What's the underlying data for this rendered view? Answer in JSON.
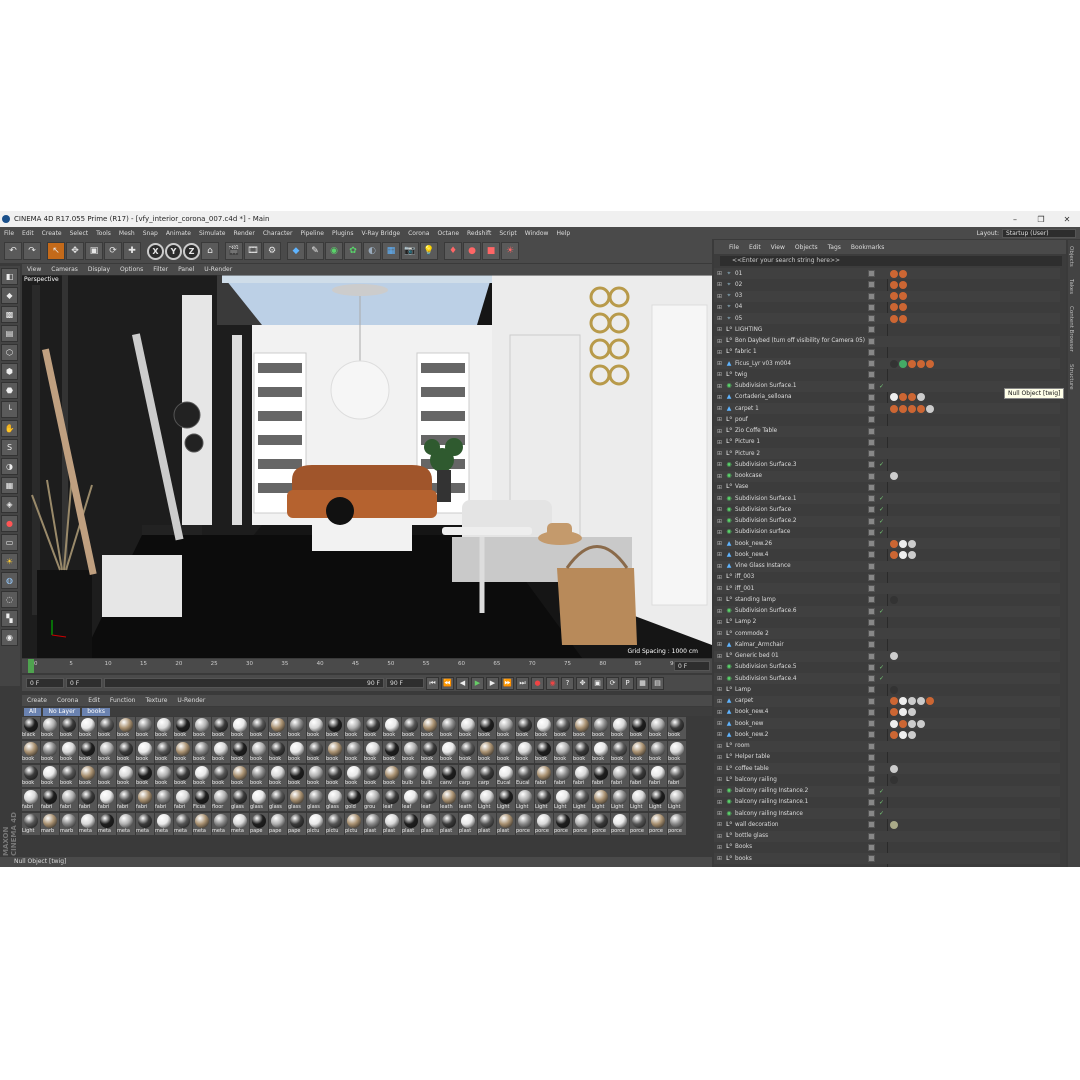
{
  "window": {
    "title": "CINEMA 4D R17.055 Prime (R17) - [vfy_interior_corona_007.c4d *] - Main",
    "min": "–",
    "max": "❐",
    "close": "✕"
  },
  "menu": [
    "File",
    "Edit",
    "Create",
    "Select",
    "Tools",
    "Mesh",
    "Snap",
    "Animate",
    "Simulate",
    "Render",
    "Character",
    "Pipeline",
    "Plugins",
    "V-Ray Bridge",
    "Corona",
    "Octane",
    "Redshift",
    "Script",
    "Window",
    "Help"
  ],
  "layout": {
    "label": "Layout:",
    "value": "Startup (User)"
  },
  "viewport": {
    "menu": [
      "View",
      "Cameras",
      "Display",
      "Options",
      "Filter",
      "Panel",
      "U-Render"
    ],
    "label": "Perspective",
    "grid_spacing": "Grid Spacing : 1000 cm"
  },
  "timeline": {
    "ticks": [
      "0",
      "5",
      "10",
      "15",
      "20",
      "25",
      "30",
      "35",
      "40",
      "45",
      "50",
      "55",
      "60",
      "65",
      "70",
      "75",
      "80",
      "85",
      "90"
    ],
    "end_field": "0 F",
    "start": "0 F",
    "min": "0 F",
    "max_slider": "90 F",
    "max": "90 F"
  },
  "materials": {
    "menu": [
      "Create",
      "Corona",
      "Edit",
      "Function",
      "Texture",
      "U-Render"
    ],
    "filters": [
      "All",
      "No Layer",
      "books"
    ],
    "rows": [
      {
        "labels": [
          "black",
          "book",
          "book",
          "book",
          "book",
          "book",
          "book",
          "book",
          "book",
          "book",
          "book",
          "book",
          "book",
          "book",
          "book",
          "book",
          "book",
          "book",
          "book",
          "book",
          "book",
          "book",
          "book",
          "book",
          "book",
          "book",
          "book",
          "book",
          "book",
          "book",
          "book",
          "book",
          "book",
          "book",
          "book"
        ],
        "color": "#222"
      },
      {
        "labels": [
          "book",
          "book",
          "book",
          "book",
          "book",
          "book",
          "book",
          "book",
          "book",
          "book",
          "book",
          "book",
          "book",
          "book",
          "book",
          "book",
          "book",
          "book",
          "book",
          "book",
          "book",
          "book",
          "book",
          "book",
          "book",
          "book",
          "book",
          "book",
          "book",
          "book",
          "book",
          "book",
          "book",
          "book",
          "book"
        ],
        "color": "#aaa"
      },
      {
        "labels": [
          "book",
          "book",
          "book",
          "book",
          "book",
          "book",
          "book",
          "book",
          "book",
          "book",
          "book",
          "book",
          "book",
          "book",
          "book",
          "book",
          "book",
          "book",
          "book",
          "book",
          "bulb",
          "bulb",
          "canv",
          "carp",
          "carp",
          "Eucal",
          "Eucal",
          "fabri",
          "fabri",
          "fabri",
          "fabri",
          "fabri",
          "fabri",
          "fabri",
          "fabri"
        ],
        "color": "#777"
      },
      {
        "labels": [
          "fabri",
          "fabri",
          "fabri",
          "fabri",
          "fabri",
          "fabri",
          "fabri",
          "fabri",
          "fabri",
          "Ficus",
          "floor",
          "glass",
          "glass",
          "glass",
          "glass",
          "glass",
          "glass",
          "gold",
          "grou",
          "leaf",
          "leaf",
          "leaf",
          "leath",
          "leath",
          "Light",
          "Light",
          "Light",
          "Light",
          "Light",
          "Light",
          "Light",
          "Light",
          "Light",
          "Light",
          "Light"
        ],
        "color": "#8a6a4a"
      },
      {
        "labels": [
          "Light",
          "marb",
          "marb",
          "meta",
          "meta",
          "meta",
          "meta",
          "meta",
          "meta",
          "meta",
          "meta",
          "meta",
          "pape",
          "pape",
          "pape",
          "pictu",
          "pictu",
          "pictu",
          "plast",
          "plast",
          "plast",
          "plast",
          "plast",
          "plast",
          "plast",
          "plast",
          "porce",
          "porce",
          "porce",
          "porce",
          "porce",
          "porce",
          "porce",
          "porce",
          "porce"
        ],
        "color": "#999"
      }
    ]
  },
  "status": "Null Object [twig]",
  "object_manager": {
    "menu": [
      "File",
      "Edit",
      "View",
      "Objects",
      "Tags",
      "Bookmarks"
    ],
    "search_placeholder": "<<Enter your search string here>>",
    "tooltip": "Null Object [twig]",
    "rows": [
      {
        "name": "01",
        "icon": "cam",
        "check": "",
        "tags": [
          "#c63",
          "#c63"
        ]
      },
      {
        "name": "02",
        "icon": "cam",
        "check": "",
        "tags": [
          "#c63",
          "#c63"
        ]
      },
      {
        "name": "03",
        "icon": "cam",
        "check": "",
        "tags": [
          "#c63",
          "#c63"
        ]
      },
      {
        "name": "04",
        "icon": "cam",
        "check": "",
        "tags": [
          "#c63",
          "#c63"
        ]
      },
      {
        "name": "05",
        "icon": "cam",
        "check": "",
        "tags": [
          "#c63",
          "#c63"
        ]
      },
      {
        "name": "LIGHTING",
        "icon": "null",
        "check": "",
        "tags": []
      },
      {
        "name": "Bon Daybed (turn off visibility for Camera 05)",
        "icon": "null",
        "check": "",
        "tags": []
      },
      {
        "name": "fabric 1",
        "icon": "null",
        "check": "",
        "tags": []
      },
      {
        "name": "Ficus_Lyr v03 m004",
        "icon": "poly",
        "check": "",
        "tags": [
          "#333",
          "#4a6",
          "#c63",
          "#c63",
          "#c63"
        ]
      },
      {
        "name": "twig",
        "icon": "null",
        "check": "",
        "tags": []
      },
      {
        "name": "Subdivision Surface.1",
        "icon": "gen",
        "check": "✓",
        "tags": []
      },
      {
        "name": "Cortaderia_selloana",
        "icon": "poly",
        "check": "",
        "tags": [
          "#eee",
          "#c63",
          "#c63",
          "#ccc"
        ]
      },
      {
        "name": "carpet 1",
        "icon": "poly",
        "check": "",
        "tags": [
          "#c63",
          "#c63",
          "#c63",
          "#c63",
          "#ccc"
        ]
      },
      {
        "name": "pouf",
        "icon": "null",
        "check": "",
        "tags": []
      },
      {
        "name": "Zio Coffe Table",
        "icon": "null",
        "check": "",
        "tags": []
      },
      {
        "name": "Picture 1",
        "icon": "null",
        "check": "",
        "tags": []
      },
      {
        "name": "Picture 2",
        "icon": "null",
        "check": "",
        "tags": []
      },
      {
        "name": "Subdivision Surface.3",
        "icon": "gen",
        "check": "✓",
        "tags": []
      },
      {
        "name": "bookcase",
        "icon": "gen",
        "check": "",
        "tags": [
          "#ccc"
        ]
      },
      {
        "name": "Vase",
        "icon": "null",
        "check": "",
        "tags": []
      },
      {
        "name": "Subdivision Surface.1",
        "icon": "gen",
        "check": "✓",
        "tags": []
      },
      {
        "name": "Subdivision Surface",
        "icon": "gen",
        "check": "✓",
        "tags": []
      },
      {
        "name": "Subdivision Surface.2",
        "icon": "gen",
        "check": "✓",
        "tags": []
      },
      {
        "name": "Subdivision surface",
        "icon": "gen",
        "check": "✓",
        "tags": []
      },
      {
        "name": "book_new.26",
        "icon": "poly",
        "check": "",
        "tags": [
          "#c63",
          "#eee",
          "#ccc"
        ]
      },
      {
        "name": "book_new.4",
        "icon": "poly",
        "check": "",
        "tags": [
          "#c63",
          "#eee",
          "#ccc"
        ]
      },
      {
        "name": "Vine Glass Instance",
        "icon": "poly",
        "check": "",
        "tags": []
      },
      {
        "name": "iff_003",
        "icon": "null",
        "check": "",
        "tags": []
      },
      {
        "name": "iff_001",
        "icon": "null",
        "check": "",
        "tags": []
      },
      {
        "name": "standing lamp",
        "icon": "null",
        "check": "",
        "tags": [
          "#333"
        ]
      },
      {
        "name": "Subdivision Surface.6",
        "icon": "gen",
        "check": "✓",
        "tags": []
      },
      {
        "name": "Lamp 2",
        "icon": "null",
        "check": "",
        "tags": []
      },
      {
        "name": "commode 2",
        "icon": "null",
        "check": "",
        "tags": []
      },
      {
        "name": "Kalmar_Armchair",
        "icon": "poly",
        "check": "",
        "tags": []
      },
      {
        "name": "Generic bed 01",
        "icon": "null",
        "check": "",
        "tags": [
          "#ccc"
        ]
      },
      {
        "name": "Subdivision Surface.5",
        "icon": "gen",
        "check": "✓",
        "tags": []
      },
      {
        "name": "Subdivision Surface.4",
        "icon": "gen",
        "check": "✓",
        "tags": []
      },
      {
        "name": "Lamp",
        "icon": "null",
        "check": "",
        "tags": [
          "#333"
        ]
      },
      {
        "name": "carpet",
        "icon": "poly",
        "check": "",
        "tags": [
          "#c63",
          "#eee",
          "#ccc",
          "#ccc",
          "#c63"
        ]
      },
      {
        "name": "book_new.4",
        "icon": "poly",
        "check": "",
        "tags": [
          "#c63",
          "#eee",
          "#ccc"
        ]
      },
      {
        "name": "book_new",
        "icon": "poly",
        "check": "",
        "tags": [
          "#eee",
          "#c63",
          "#ccc",
          "#ccc"
        ]
      },
      {
        "name": "book_new.2",
        "icon": "poly",
        "check": "",
        "tags": [
          "#c63",
          "#eee",
          "#ccc"
        ]
      },
      {
        "name": "room",
        "icon": "null",
        "check": "",
        "tags": []
      },
      {
        "name": "Helper table",
        "icon": "null",
        "check": "",
        "tags": []
      },
      {
        "name": "coffee table",
        "icon": "null",
        "check": "",
        "tags": [
          "#ccc"
        ]
      },
      {
        "name": "balcony railing",
        "icon": "null",
        "check": "",
        "tags": [
          "#333"
        ]
      },
      {
        "name": "balcony railing Instance.2",
        "icon": "gen",
        "check": "✓",
        "tags": []
      },
      {
        "name": "balcony railing Instance.1",
        "icon": "gen",
        "check": "✓",
        "tags": []
      },
      {
        "name": "balcony railing Instance",
        "icon": "gen",
        "check": "✓",
        "tags": []
      },
      {
        "name": "wall decoration",
        "icon": "null",
        "check": "",
        "tags": [
          "#aa8"
        ]
      },
      {
        "name": "bottle glass",
        "icon": "null",
        "check": "",
        "tags": []
      },
      {
        "name": "Books",
        "icon": "null",
        "check": "",
        "tags": []
      },
      {
        "name": "books",
        "icon": "null",
        "check": "",
        "tags": []
      }
    ]
  },
  "side_tabs": [
    "Objects",
    "Takes",
    "Content Browser",
    "Structure"
  ]
}
